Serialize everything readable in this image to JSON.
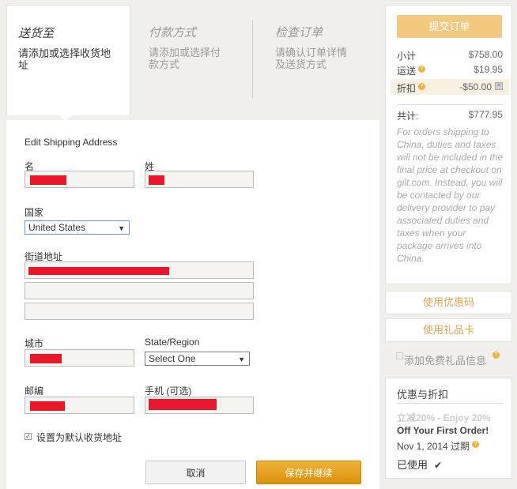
{
  "steps": [
    {
      "title": "送货至",
      "desc": "请添加或选择收货地址"
    },
    {
      "title": "付款方式",
      "desc": "请添加或选择付款方式"
    },
    {
      "title": "检查订单",
      "desc": "请确认订单详情及送货方式"
    }
  ],
  "form": {
    "heading": "Edit Shipping Address",
    "first_name_label": "名",
    "last_name_label": "姓",
    "country_label": "国家",
    "country_value": "United States",
    "street_label": "街道地址",
    "city_label": "城市",
    "state_label": "State/Region",
    "state_value": "Select One",
    "zip_label": "邮编",
    "phone_label": "手机 (可选)",
    "default_label": "设置为默认收货地址",
    "cancel_label": "取消",
    "save_label": "保存并继续"
  },
  "summary": {
    "submit_label": "提交订单",
    "subtotal_label": "小计",
    "subtotal_value": "$758.00",
    "shipping_label": "运送",
    "shipping_value": "$19.95",
    "discount_label": "折扣",
    "discount_value": "-$50.00",
    "total_label": "共计:",
    "total_value": "$777.95",
    "note": "For orders shipping to China, duties and taxes will not be included in the final price at checkout on gilt.com. Instead, you will be contacted by our delivery provider to pay associated duties and taxes when your package arrives into China."
  },
  "sidebar": {
    "coupon_label": "使用优惠码",
    "gift_card_label": "使用礼品卡",
    "gift_message_label": "添加免费礼品信息"
  },
  "promo": {
    "title": "优惠与折扣",
    "name_line1": "立减20% - Enjoy 20%",
    "name_line2": "Off Your First Order!",
    "expiry": "Nov 1, 2014 过期",
    "used_label": "已使用"
  },
  "colors": {
    "accent": "#e09d1b",
    "accent_light": "#f1c87d",
    "redaction": "#e8182a"
  }
}
